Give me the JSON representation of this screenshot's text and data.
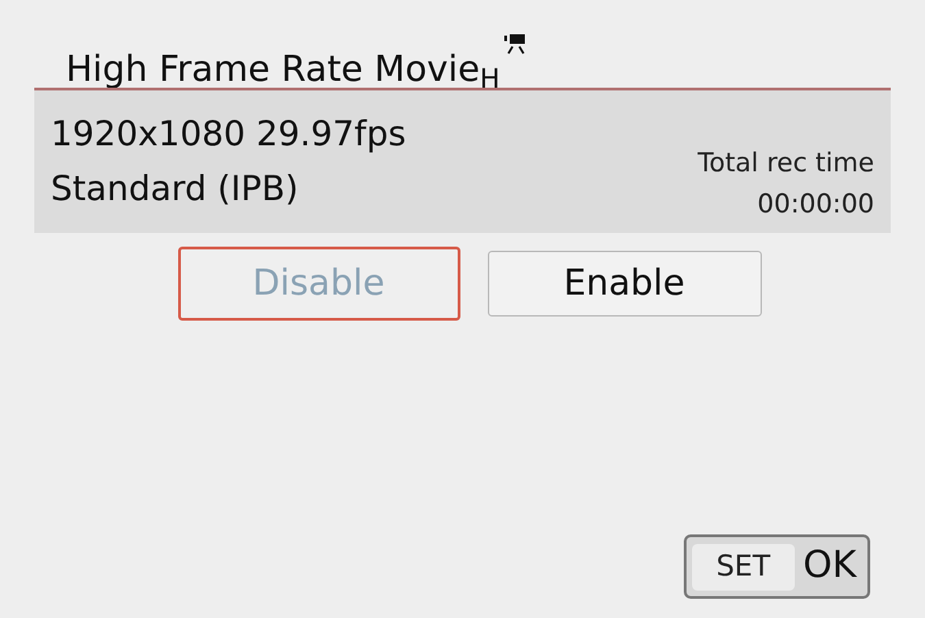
{
  "title": "High Frame Rate Movie$_{H}$",
  "info": {
    "resolution": "1920x1080 29.97fps",
    "compression": "Standard (IPB)",
    "rec_time_label": "Total rec time",
    "rec_time": "00:00:00"
  },
  "options": [
    {
      "label": "Disable",
      "selected": true
    },
    {
      "label": "Enable",
      "selected": false
    }
  ],
  "ok_button": {
    "key": "SET",
    "label": "OK"
  }
}
